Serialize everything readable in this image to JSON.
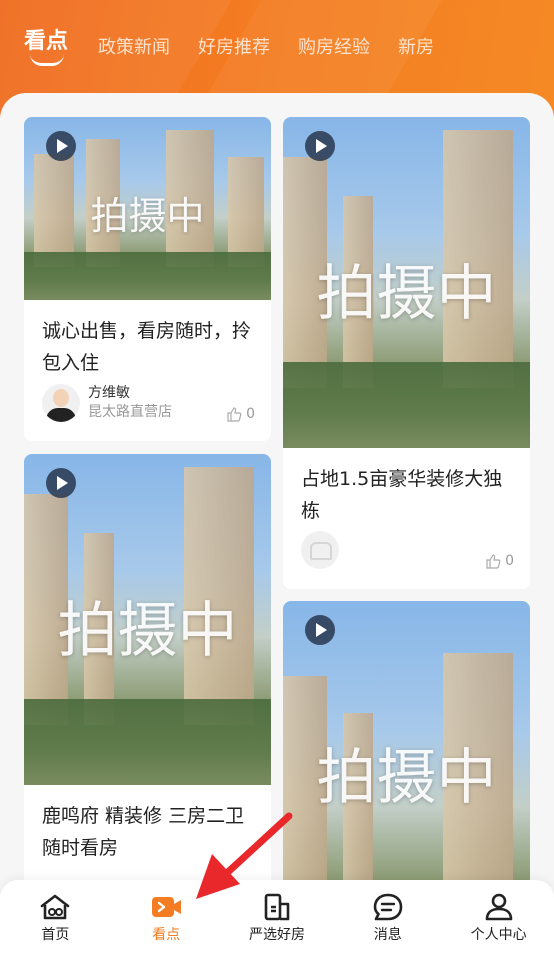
{
  "header": {
    "tabs": [
      {
        "label": "看点",
        "active": true
      },
      {
        "label": "政策新闻"
      },
      {
        "label": "好房推荐"
      },
      {
        "label": "购房经验"
      },
      {
        "label": "新房"
      }
    ]
  },
  "cards": [
    {
      "overlay_text": "拍摄中",
      "title": "诚心出售，看房随时，拎包入住",
      "author_name": "方维敏",
      "author_store": "昆太路直营店",
      "likes": "0"
    },
    {
      "overlay_text": "拍摄中",
      "title": "占地1.5亩豪华装修大独栋",
      "likes": "0"
    },
    {
      "overlay_text": "拍摄中",
      "title": "鹿鸣府 精装修 三房二卫 随时看房"
    },
    {
      "overlay_text": "拍摄中"
    }
  ],
  "navbar": {
    "items": [
      {
        "label": "首页",
        "icon": "home-icon"
      },
      {
        "label": "看点",
        "icon": "video-camera-icon",
        "active": true
      },
      {
        "label": "严选好房",
        "icon": "building-icon"
      },
      {
        "label": "消息",
        "icon": "message-icon"
      },
      {
        "label": "个人中心",
        "icon": "person-icon"
      }
    ]
  },
  "colors": {
    "accent": "#f47c22",
    "arrow": "#e8282b"
  }
}
